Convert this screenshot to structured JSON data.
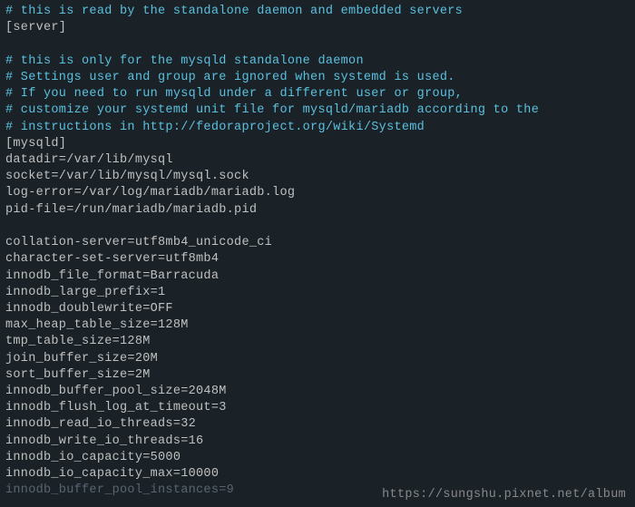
{
  "lines": [
    {
      "text": "# this is read by the standalone daemon and embedded servers",
      "cls": "comment"
    },
    {
      "text": "[server]",
      "cls": ""
    },
    {
      "text": "",
      "cls": "blank"
    },
    {
      "text": "# this is only for the mysqld standalone daemon",
      "cls": "comment"
    },
    {
      "text": "# Settings user and group are ignored when systemd is used.",
      "cls": "comment"
    },
    {
      "text": "# If you need to run mysqld under a different user or group,",
      "cls": "comment"
    },
    {
      "text": "# customize your systemd unit file for mysqld/mariadb according to the",
      "cls": "comment"
    },
    {
      "text": "# instructions in http://fedoraproject.org/wiki/Systemd",
      "cls": "comment"
    },
    {
      "text": "[mysqld]",
      "cls": ""
    },
    {
      "text": "datadir=/var/lib/mysql",
      "cls": ""
    },
    {
      "text": "socket=/var/lib/mysql/mysql.sock",
      "cls": ""
    },
    {
      "text": "log-error=/var/log/mariadb/mariadb.log",
      "cls": ""
    },
    {
      "text": "pid-file=/run/mariadb/mariadb.pid",
      "cls": ""
    },
    {
      "text": "",
      "cls": "blank"
    },
    {
      "text": "collation-server=utf8mb4_unicode_ci",
      "cls": ""
    },
    {
      "text": "character-set-server=utf8mb4",
      "cls": ""
    },
    {
      "text": "innodb_file_format=Barracuda",
      "cls": ""
    },
    {
      "text": "innodb_large_prefix=1",
      "cls": ""
    },
    {
      "text": "innodb_doublewrite=OFF",
      "cls": ""
    },
    {
      "text": "max_heap_table_size=128M",
      "cls": ""
    },
    {
      "text": "tmp_table_size=128M",
      "cls": ""
    },
    {
      "text": "join_buffer_size=20M",
      "cls": ""
    },
    {
      "text": "sort_buffer_size=2M",
      "cls": ""
    },
    {
      "text": "innodb_buffer_pool_size=2048M",
      "cls": ""
    },
    {
      "text": "innodb_flush_log_at_timeout=3",
      "cls": ""
    },
    {
      "text": "innodb_read_io_threads=32",
      "cls": ""
    },
    {
      "text": "innodb_write_io_threads=16",
      "cls": ""
    },
    {
      "text": "innodb_io_capacity=5000",
      "cls": ""
    },
    {
      "text": "innodb_io_capacity_max=10000",
      "cls": ""
    },
    {
      "text": "innodb_buffer_pool_instances=9",
      "cls": "faded"
    }
  ],
  "watermark": "https://sungshu.pixnet.net/album"
}
